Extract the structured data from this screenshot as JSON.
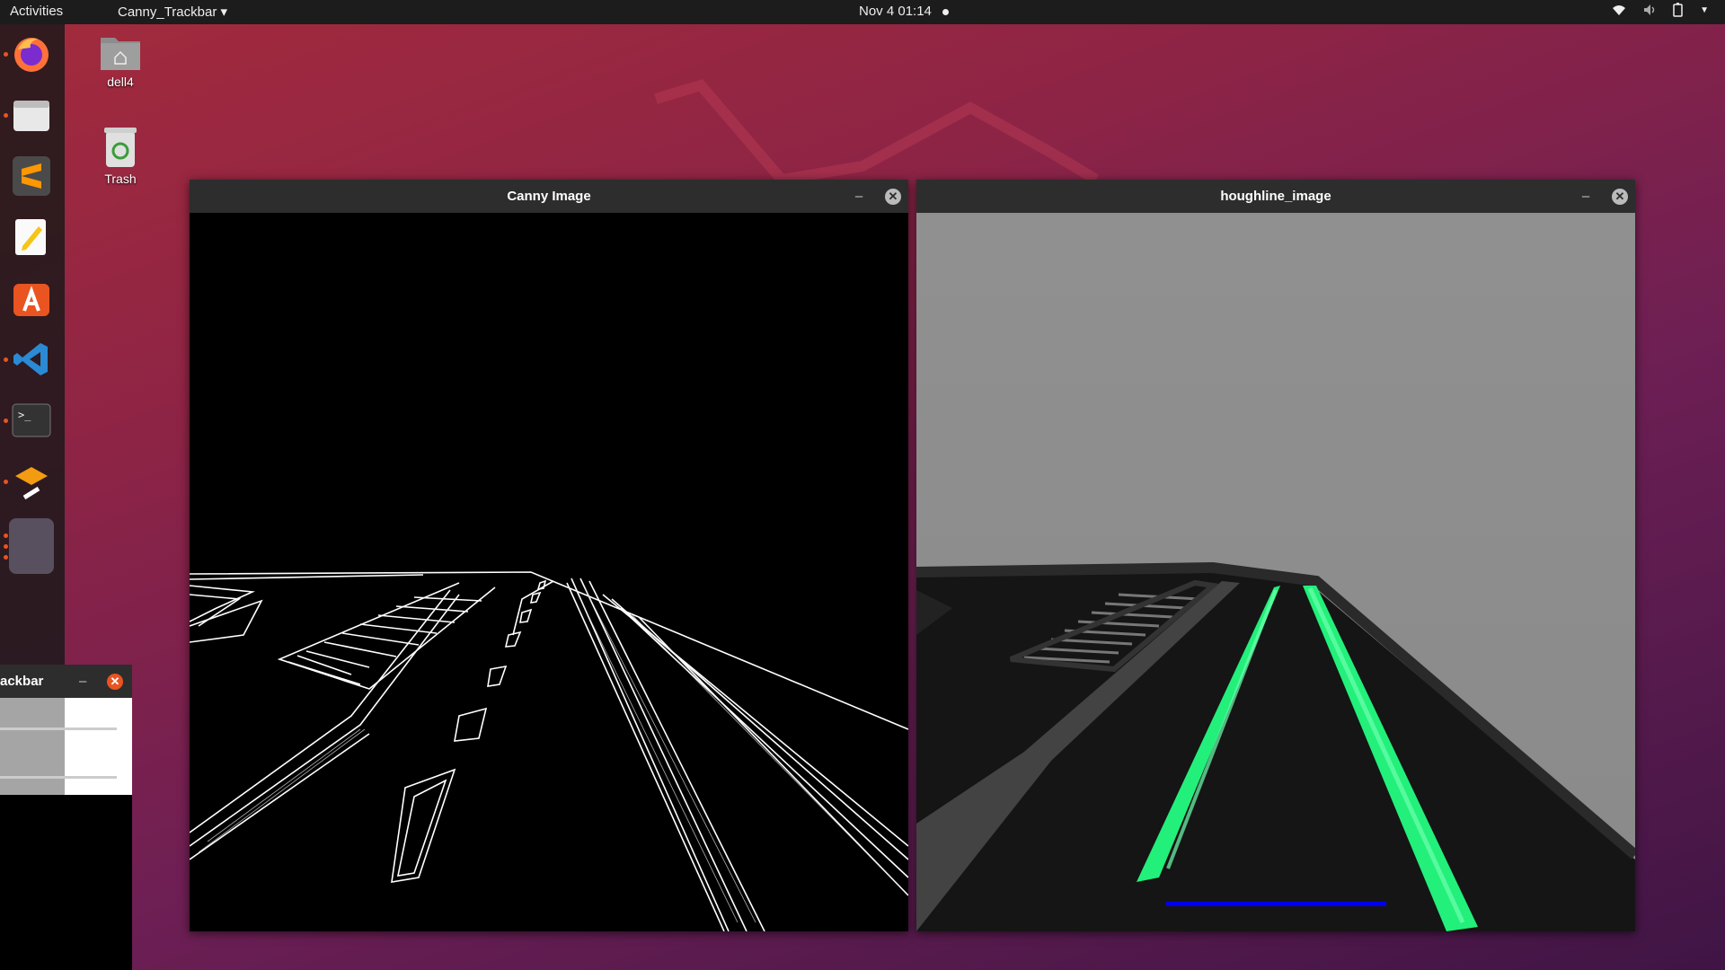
{
  "topbar": {
    "activities": "Activities",
    "app_menu": "Canny_Trackbar ▾",
    "clock": "Nov 4  01:14"
  },
  "dock": {
    "items": [
      {
        "name": "firefox-icon",
        "running": true
      },
      {
        "name": "files-icon",
        "running": true
      },
      {
        "name": "sublime-text-icon",
        "running": false
      },
      {
        "name": "text-editor-icon",
        "running": false
      },
      {
        "name": "software-center-icon",
        "running": false
      },
      {
        "name": "vscode-icon",
        "running": true
      },
      {
        "name": "terminal-icon",
        "running": true
      },
      {
        "name": "app-icon",
        "running": true
      },
      {
        "name": "opencv-window-icon",
        "running": true
      }
    ],
    "show_apps": "show-apps-icon"
  },
  "desktop": {
    "home_label": "dell4",
    "trash_label": "Trash"
  },
  "windows": {
    "canny": {
      "title": "Canny Image"
    },
    "hough": {
      "title": "houghline_image"
    },
    "trackbar": {
      "title_fragment": "ackbar"
    }
  },
  "colors": {
    "accent": "#e95420",
    "lane_green": "#22f07a",
    "lane_blue": "#0000ee"
  }
}
